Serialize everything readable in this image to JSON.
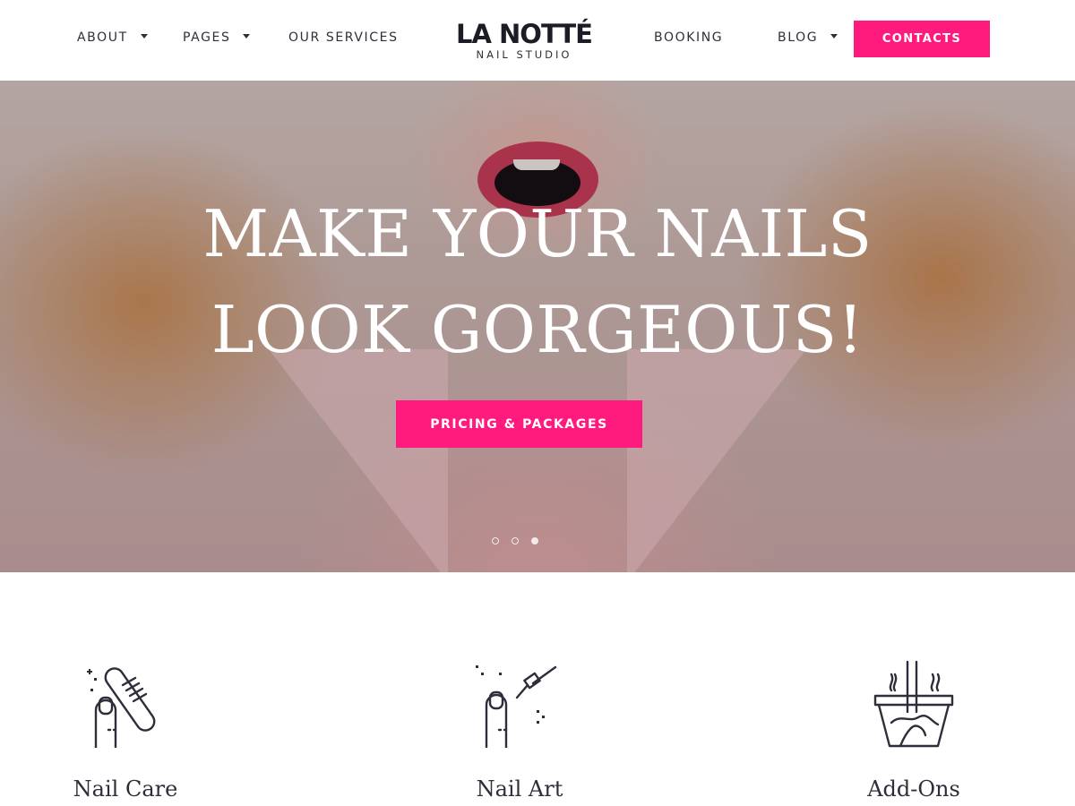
{
  "header": {
    "nav_left": [
      {
        "label": "ABOUT",
        "has_caret": true
      },
      {
        "label": "PAGES",
        "has_caret": true
      },
      {
        "label": "OUR SERVICES",
        "has_caret": false
      }
    ],
    "logo": {
      "main": "LA NOTTÉ",
      "sub": "NAIL STUDIO"
    },
    "nav_right": [
      {
        "label": "BOOKING",
        "has_caret": false
      },
      {
        "label": "BLOG",
        "has_caret": true
      }
    ],
    "contacts_label": "CONTACTS"
  },
  "hero": {
    "title_line1": "MAKE YOUR NAILS",
    "title_line2": "LOOK GORGEOUS!",
    "button_label": "PRICING & PACKAGES",
    "slides": 3,
    "active_slide": 3
  },
  "services": [
    {
      "title": "Nail Care",
      "icon": "nail-file-icon"
    },
    {
      "title": "Nail Art",
      "icon": "nail-polish-brush-icon"
    },
    {
      "title": "Add-Ons",
      "icon": "spa-bowl-icon"
    }
  ],
  "colors": {
    "accent": "#ff1a7e",
    "text": "#2e2e3a"
  }
}
